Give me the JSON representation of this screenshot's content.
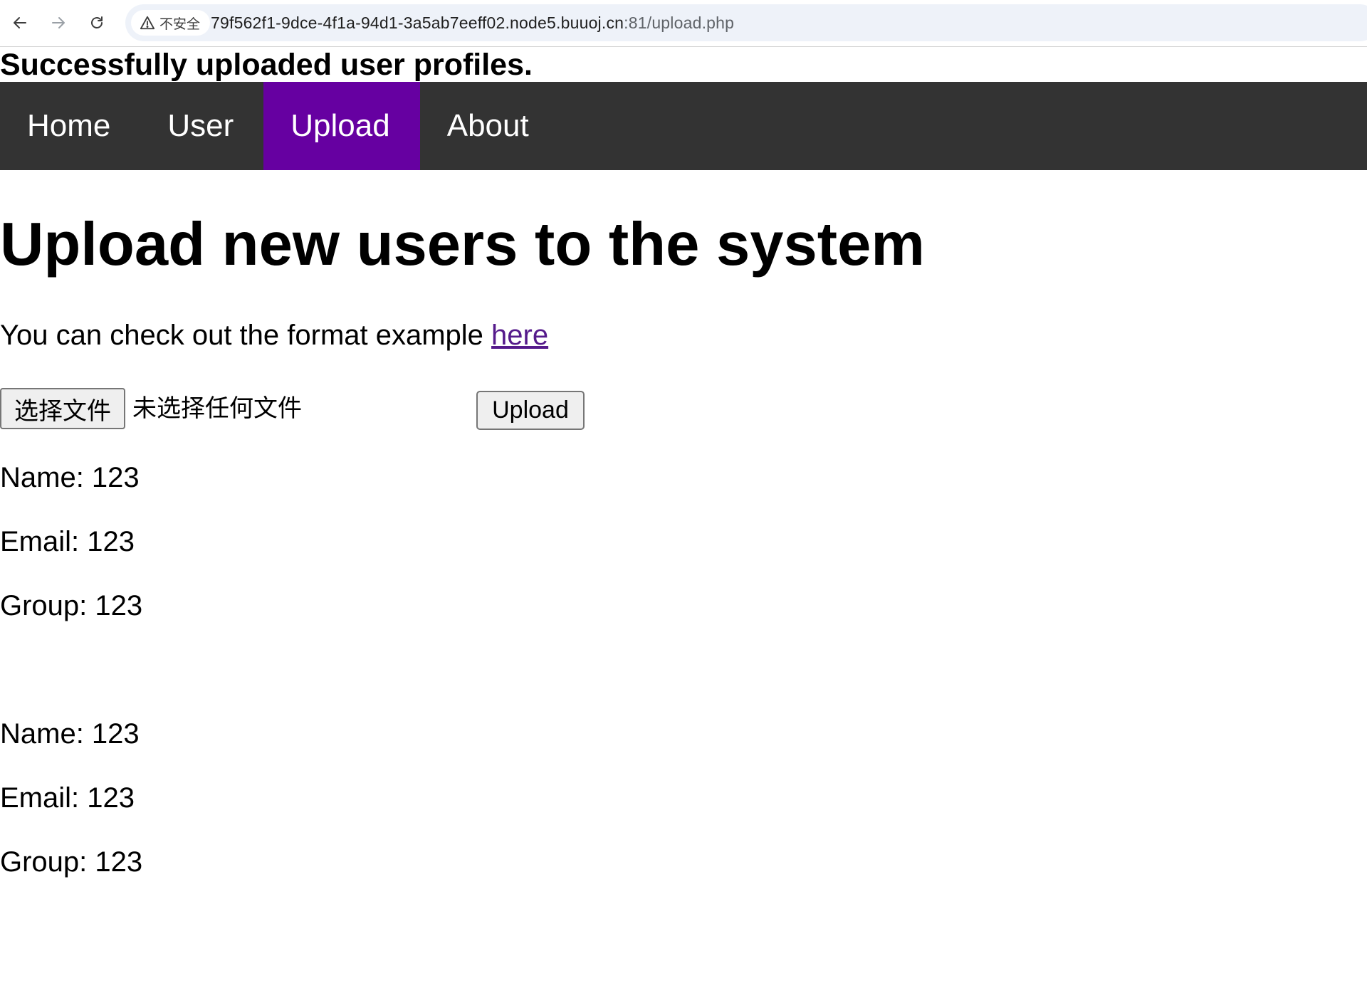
{
  "browser": {
    "back_icon": "arrow-left-icon",
    "forward_icon": "arrow-right-icon",
    "reload_icon": "reload-icon",
    "security_label": "不安全",
    "url_host": "79f562f1-9dce-4f1a-94d1-3a5ab7eeff02.node5.buuoj.cn",
    "url_path": ":81/upload.php"
  },
  "page": {
    "flash_message": "Successfully uploaded user profiles.",
    "nav": {
      "items": [
        {
          "label": "Home"
        },
        {
          "label": "User"
        },
        {
          "label": "Upload"
        },
        {
          "label": "About"
        }
      ],
      "active": "Upload"
    },
    "heading": "Upload new users to the system",
    "format_hint": "You can check out the format example ",
    "format_link": "here",
    "file_button": "选择文件",
    "file_status": "未选择任何文件",
    "upload_button": "Upload",
    "users": [
      {
        "name": "Name: 123",
        "email": "Email: 123",
        "group": "Group: 123"
      },
      {
        "name": "Name: 123",
        "email": "Email: 123",
        "group": "Group: 123"
      }
    ]
  },
  "colors": {
    "nav_bg": "#333333",
    "nav_active": "#6600a1",
    "link": "#551a8b",
    "omnibox_bg": "#eef2f9"
  }
}
